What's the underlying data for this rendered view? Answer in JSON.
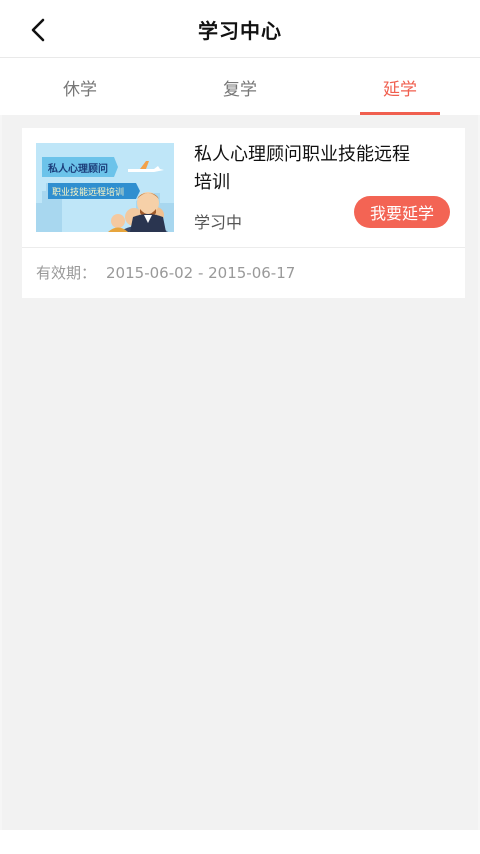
{
  "header": {
    "title": "学习中心"
  },
  "tabs": [
    {
      "label": "休学",
      "active": false
    },
    {
      "label": "复学",
      "active": false
    },
    {
      "label": "延学",
      "active": true
    }
  ],
  "course": {
    "thumbnail": {
      "banner_title": "私人心理顾问",
      "banner_subtitle": "职业技能远程培训"
    },
    "title": "私人心理顾问职业技能远程培训",
    "status": "学习中",
    "action_label": "我要延学",
    "validity_label": "有效期：",
    "validity_dates": "2015-06-02 - 2015-06-17"
  },
  "colors": {
    "accent": "#f05f4f",
    "button": "#f36454",
    "background": "#f2f2f2"
  }
}
